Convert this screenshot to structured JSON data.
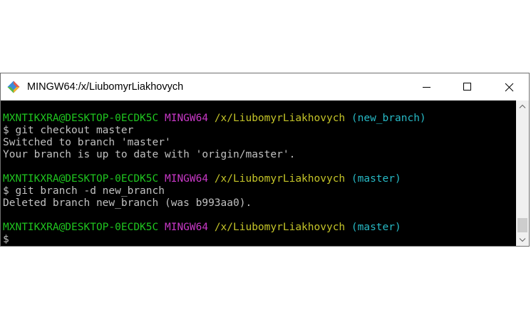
{
  "window": {
    "title": "MINGW64:/x/LiubomyrLiakhovych",
    "icon": "git-icon"
  },
  "controls": {
    "minimize_icon": "minimize-icon",
    "maximize_icon": "maximize-icon",
    "close_icon": "close-icon"
  },
  "colors": {
    "user": "#1fc51f",
    "system": "#c838c6",
    "path": "#c4c428",
    "branch": "#27b9c5",
    "text": "#c0c0c0",
    "terminal_bg": "#000000"
  },
  "terminal": {
    "prompt1": {
      "user": "MXNTIKXRA@DESKTOP-0ECDK5C",
      "system": "MINGW64",
      "path": "/x/LiubomyrLiakhovych",
      "branch": "(new_branch)"
    },
    "cmd1": "$ git checkout master",
    "out1a": "Switched to branch 'master'",
    "out1b": "Your branch is up to date with 'origin/master'.",
    "prompt2": {
      "user": "MXNTIKXRA@DESKTOP-0ECDK5C",
      "system": "MINGW64",
      "path": "/x/LiubomyrLiakhovych",
      "branch": "(master)"
    },
    "cmd2": "$ git branch -d new_branch",
    "out2": "Deleted branch new_branch (was b993aa0).",
    "prompt3": {
      "user": "MXNTIKXRA@DESKTOP-0ECDK5C",
      "system": "MINGW64",
      "path": "/x/LiubomyrLiakhovych",
      "branch": "(master)"
    },
    "cursor_line": "$"
  }
}
